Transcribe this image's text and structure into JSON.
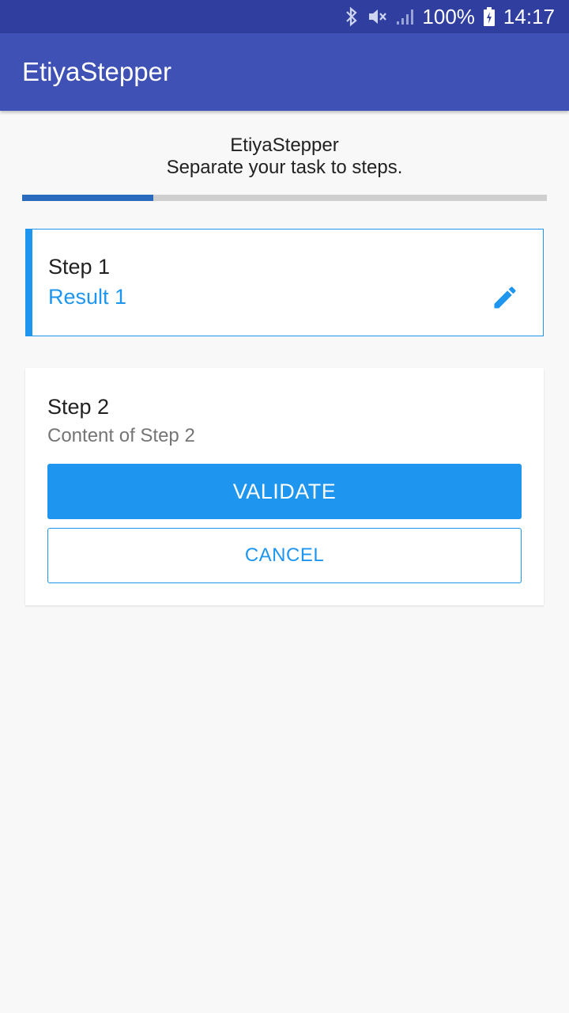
{
  "status_bar": {
    "icons": [
      "bluetooth-icon",
      "mute-icon",
      "signal-icon",
      "battery-charging-icon"
    ],
    "battery": "100%",
    "time": "14:17",
    "color": "#303f9f"
  },
  "app_bar": {
    "title": "EtiyaStepper",
    "color": "#3f51b5"
  },
  "header": {
    "title": "EtiyaStepper",
    "subtitle": "Separate your task to steps."
  },
  "progress": {
    "fraction": 0.25,
    "fill_color": "#2a6bbd",
    "track_color": "#cfcfcf"
  },
  "steps": [
    {
      "title": "Step 1",
      "result": "Result 1",
      "edit_icon": "edit-pencil-icon",
      "accent_color": "#1e96f0"
    },
    {
      "title": "Step 2",
      "content": "Content of Step 2",
      "validate_label": "VALIDATE",
      "cancel_label": "CANCEL"
    }
  ],
  "colors": {
    "accent": "#1e96f0",
    "background": "#f8f8f8"
  }
}
